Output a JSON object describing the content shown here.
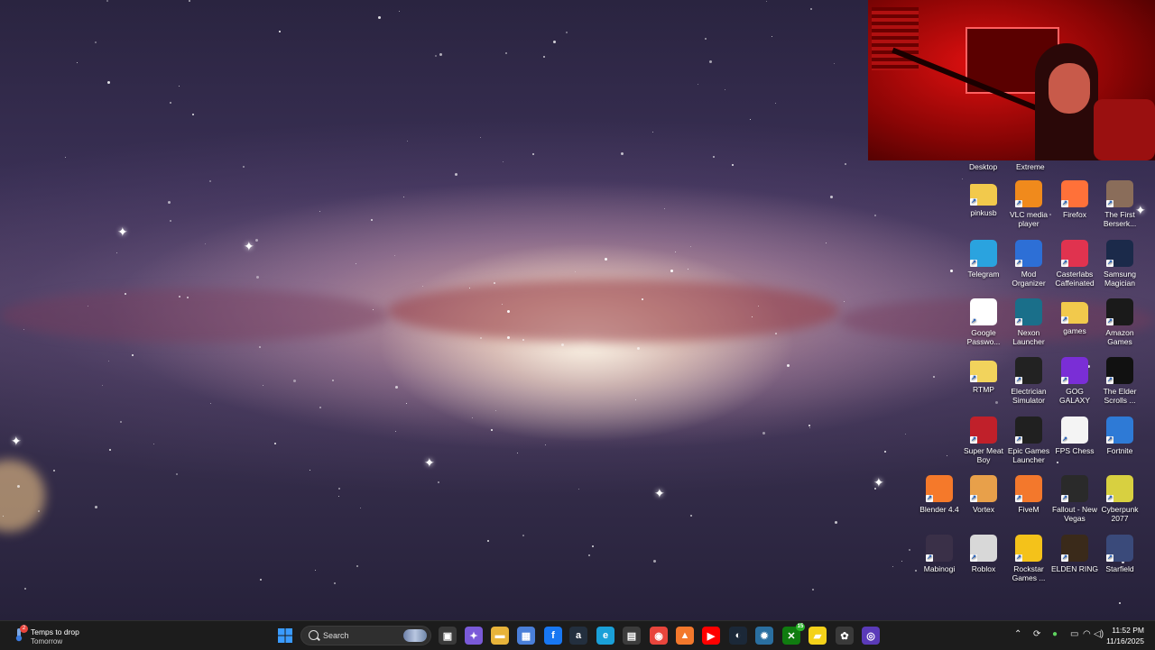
{
  "desktop": {
    "top_labels": [
      "Desktop",
      "Extreme"
    ],
    "icons": [
      {
        "label": "pinkusb",
        "icon": "folder-icon",
        "color": "#f2c94c"
      },
      {
        "label": "VLC media player",
        "icon": "vlc-icon",
        "color": "#f08a1c"
      },
      {
        "label": "Firefox",
        "icon": "firefox-icon",
        "color": "#ff7139"
      },
      {
        "label": "The First Berserk...",
        "icon": "game-icon",
        "color": "#8a6d5a"
      },
      {
        "label": "Telegram",
        "icon": "telegram-icon",
        "color": "#2aa3df"
      },
      {
        "label": "Mod Organizer",
        "icon": "mod-organizer-icon",
        "color": "#2d6fd6"
      },
      {
        "label": "Casterlabs Caffeinated",
        "icon": "casterlabs-icon",
        "color": "#e0334f"
      },
      {
        "label": "Samsung Magician",
        "icon": "samsung-magician-icon",
        "color": "#1b2a4a"
      },
      {
        "label": "Google Passwo...",
        "icon": "google-password-icon",
        "color": "#ffffff"
      },
      {
        "label": "Nexon Launcher",
        "icon": "nexon-icon",
        "color": "#1a6f8a"
      },
      {
        "label": "games",
        "icon": "folder-icon",
        "color": "#f2c94c"
      },
      {
        "label": "Amazon Games",
        "icon": "amazon-games-icon",
        "color": "#1a1a1a"
      },
      {
        "label": "RTMP",
        "icon": "folder-icon",
        "color": "#f2d35c"
      },
      {
        "label": "Electrician Simulator",
        "icon": "electrician-simulator-icon",
        "color": "#222222"
      },
      {
        "label": "GOG GALAXY",
        "icon": "gog-galaxy-icon",
        "color": "#7a2ed6"
      },
      {
        "label": "The Elder Scrolls ...",
        "icon": "elder-scrolls-icon",
        "color": "#111111"
      },
      {
        "label": "Super Meat Boy",
        "icon": "super-meat-boy-icon",
        "color": "#c0202a"
      },
      {
        "label": "Epic Games Launcher",
        "icon": "epic-games-icon",
        "color": "#202020"
      },
      {
        "label": "FPS Chess",
        "icon": "file-icon",
        "color": "#f4f4f4"
      },
      {
        "label": "Fortnite",
        "icon": "fortnite-icon",
        "color": "#2e7ad6"
      },
      {
        "label": "Blender 4.4",
        "icon": "blender-icon",
        "color": "#f5792a"
      },
      {
        "label": "Vortex",
        "icon": "vortex-icon",
        "color": "#e8a04a"
      },
      {
        "label": "FiveM",
        "icon": "fivem-icon",
        "color": "#f3782c"
      },
      {
        "label": "Fallout - New Vegas",
        "icon": "fallout-icon",
        "color": "#2a2a2a"
      },
      {
        "label": "Cyberpunk 2077",
        "icon": "cyberpunk-icon",
        "color": "#d8d040"
      },
      {
        "label": "Mabinogi",
        "icon": "mabinogi-icon",
        "color": "#3a3048"
      },
      {
        "label": "Roblox",
        "icon": "roblox-icon",
        "color": "#d8d8d8"
      },
      {
        "label": "Rockstar Games ...",
        "icon": "rockstar-icon",
        "color": "#f4c21a"
      },
      {
        "label": "ELDEN RING",
        "icon": "elden-ring-icon",
        "color": "#3a2a1a"
      },
      {
        "label": "Starfield",
        "icon": "starfield-icon",
        "color": "#3a4a7a"
      }
    ]
  },
  "taskbar": {
    "weather": {
      "title": "Temps to drop",
      "subtitle": "Tomorrow",
      "badge": "2"
    },
    "search": {
      "placeholder": "Search"
    },
    "apps": [
      {
        "name": "start-button",
        "icon": "windows-icon",
        "color": "#2f8cff",
        "glyph": "⊞"
      },
      {
        "name": "task-view-button",
        "icon": "task-view-icon",
        "color": "#3a3a3a",
        "glyph": "▣"
      },
      {
        "name": "copilot-button",
        "icon": "copilot-icon",
        "color": "#7a5ad8",
        "glyph": "✦"
      },
      {
        "name": "file-explorer-button",
        "icon": "folder-icon",
        "color": "#e8b43a",
        "glyph": "▬"
      },
      {
        "name": "store-button",
        "icon": "store-icon",
        "color": "#4a7fd8",
        "glyph": "▦"
      },
      {
        "name": "facebook-button",
        "icon": "facebook-icon",
        "color": "#1877f2",
        "glyph": "f"
      },
      {
        "name": "amazon-button",
        "icon": "amazon-icon",
        "color": "#232f3e",
        "glyph": "a"
      },
      {
        "name": "edge-button",
        "icon": "edge-icon",
        "color": "#1aa0d8",
        "glyph": "e"
      },
      {
        "name": "calculator-button",
        "icon": "calculator-icon",
        "color": "#3c3c3c",
        "glyph": "▤"
      },
      {
        "name": "chrome-button",
        "icon": "chrome-icon",
        "color": "#e8453c",
        "glyph": "◉"
      },
      {
        "name": "fivem-button",
        "icon": "fivem-icon",
        "color": "#f3782c",
        "glyph": "▲"
      },
      {
        "name": "youtube-button",
        "icon": "youtube-icon",
        "color": "#ff0000",
        "glyph": "▶"
      },
      {
        "name": "steam-button",
        "icon": "steam-icon",
        "color": "#1b2838",
        "glyph": "◐"
      },
      {
        "name": "app-button",
        "icon": "gear-icon",
        "color": "#2a6fa0",
        "glyph": "✹"
      },
      {
        "name": "xbox-button",
        "icon": "xbox-icon",
        "color": "#107c10",
        "glyph": "✕"
      },
      {
        "name": "sticky-notes-button",
        "icon": "sticky-notes-icon",
        "color": "#f4d21a",
        "glyph": "▰"
      },
      {
        "name": "chatgpt-button",
        "icon": "openai-icon",
        "color": "#3a3a3a",
        "glyph": "✿"
      },
      {
        "name": "obs-button",
        "icon": "obs-icon",
        "color": "#5a3ab8",
        "glyph": "◎"
      }
    ],
    "xbox_badge": "15",
    "tray": [
      "chevron-up-icon",
      "refresh-icon",
      "microphone-icon",
      "display-icon",
      "wifi-icon",
      "volume-icon"
    ],
    "clock": {
      "time": "11:52 PM",
      "date": "11/16/2025"
    }
  }
}
